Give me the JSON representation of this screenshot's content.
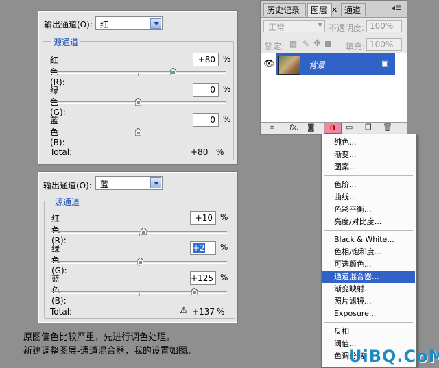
{
  "panel1": {
    "output_label": "输出通道(O):",
    "output_value": "红",
    "group_title": "源通道",
    "rows": [
      {
        "label": "红色(R):",
        "value": "+80",
        "unit": "%",
        "level": 80
      },
      {
        "label": "绿色(G):",
        "value": "0",
        "unit": "%",
        "level": 0
      },
      {
        "label": "蓝色(B):",
        "value": "0",
        "unit": "%",
        "level": 0
      }
    ],
    "total_label": "Total:",
    "total_value": "+80",
    "total_unit": "%"
  },
  "panel2": {
    "output_label": "输出通道(O):",
    "output_value": "蓝",
    "group_title": "源通道",
    "rows": [
      {
        "label": "红色(R):",
        "value": "+10",
        "unit": "%",
        "level": 10
      },
      {
        "label": "绿色(G):",
        "value": "+2",
        "unit": "%",
        "level": 2
      },
      {
        "label": "蓝色(B):",
        "value": "+125",
        "unit": "%",
        "level": 125
      }
    ],
    "total_label": "Total:",
    "total_value": "+137",
    "total_unit": "%"
  },
  "layers": {
    "tabs": [
      "历史记录",
      "图层",
      "通道"
    ],
    "blend_mode": "正常",
    "opacity_label": "不透明度:",
    "opacity_value": "100%",
    "lock_label": "锁定:",
    "fill_label": "填充:",
    "fill_value": "100%",
    "layer_name": "背景"
  },
  "menu": {
    "groups": [
      [
        "纯色...",
        "渐变...",
        "图案..."
      ],
      [
        "色阶...",
        "曲线...",
        "色彩平衡...",
        "亮度/对比度..."
      ],
      [
        "Black & White...",
        "色相/饱和度...",
        "可选颜色...",
        "通道混合器...",
        "渐变映射...",
        "照片滤镜...",
        "Exposure..."
      ],
      [
        "反相",
        "阈值...",
        "色调分离..."
      ]
    ],
    "highlighted": "通道混合器..."
  },
  "caption": {
    "line1": "原图偏色比较严重，先进行调色处理。",
    "line2": "新建调整图层-通道混合器，我的设置如图。"
  },
  "watermark": "UiBQ.CoM",
  "colors": {
    "highlight": "#3062c8",
    "group_title": "#1a4db3"
  }
}
